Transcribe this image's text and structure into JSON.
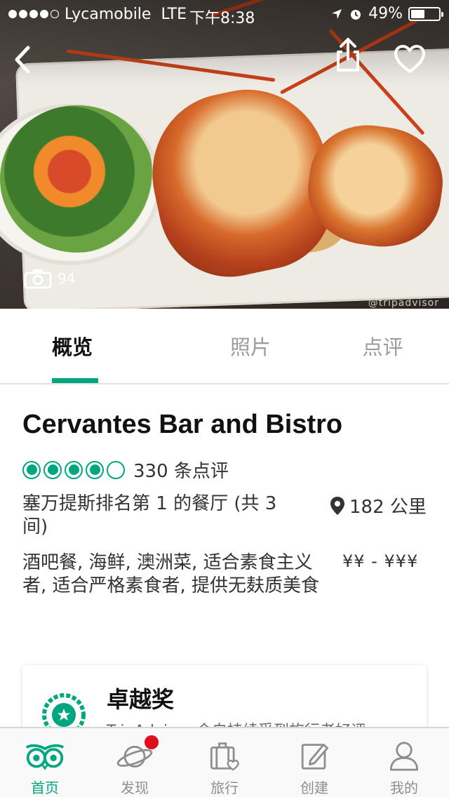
{
  "status_bar": {
    "carrier": "Lycamobile",
    "network": "LTE",
    "time": "下午8:38",
    "battery": "49%",
    "battery_level": 0.49
  },
  "hero": {
    "photo_count": "94",
    "watermark": "@tripadvisor"
  },
  "tabs": [
    {
      "label": "概览",
      "active": true
    },
    {
      "label": "照片",
      "active": false
    },
    {
      "label": "点评",
      "active": false
    }
  ],
  "restaurant": {
    "name": "Cervantes Bar and Bistro",
    "rating": 4,
    "rating_max": 5,
    "review_count": "330 条点评",
    "ranking": "塞万提斯排名第 1 的餐厅 (共 3 间)",
    "distance": "182 公里",
    "cuisines": "酒吧餐, 海鲜, 澳洲菜, 适合素食主义者, 适合严格素食者, 提供无麸质美食",
    "price": "¥¥ - ¥¥¥"
  },
  "award": {
    "title": "卓越奖",
    "description": "TripAdvisor 会自持续受到旅行者好评"
  },
  "nav": [
    {
      "label": "首页",
      "icon": "owl-logo-icon",
      "active": true
    },
    {
      "label": "发现",
      "icon": "planet-icon",
      "active": false,
      "notification": true
    },
    {
      "label": "旅行",
      "icon": "suitcase-heart-icon",
      "active": false
    },
    {
      "label": "创建",
      "icon": "compose-icon",
      "active": false
    },
    {
      "label": "我的",
      "icon": "person-icon",
      "active": false
    }
  ],
  "colors": {
    "accent": "#00a680",
    "notification": "#e00e1b"
  }
}
